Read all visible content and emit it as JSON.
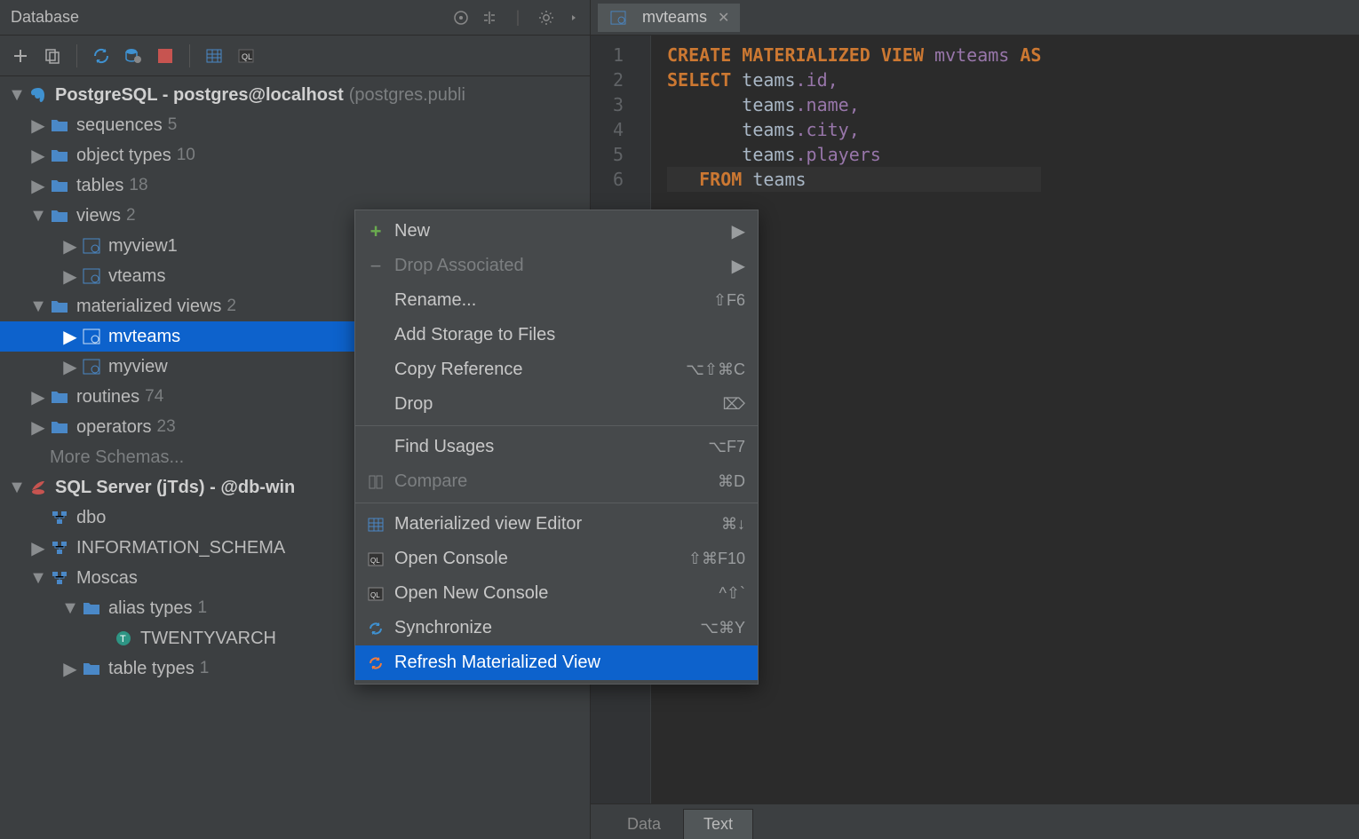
{
  "panel": {
    "title": "Database"
  },
  "tree": {
    "pg_label": "PostgreSQL - postgres@localhost",
    "pg_sub": "(postgres.publi",
    "sequences": {
      "label": "sequences",
      "count": "5"
    },
    "object_types": {
      "label": "object types",
      "count": "10"
    },
    "tables": {
      "label": "tables",
      "count": "18"
    },
    "views": {
      "label": "views",
      "count": "2"
    },
    "myview1": "myview1",
    "vteams": "vteams",
    "mviews": {
      "label": "materialized views",
      "count": "2"
    },
    "mvteams": "mvteams",
    "myview": "myview",
    "routines": {
      "label": "routines",
      "count": "74"
    },
    "operators": {
      "label": "operators",
      "count": "23"
    },
    "more_schemas": "More Schemas...",
    "mssql_label": "SQL Server (jTds) - @db-win",
    "dbo": "dbo",
    "info_schema": "INFORMATION_SCHEMA",
    "moscas": "Moscas",
    "alias_types": {
      "label": "alias types",
      "count": "1"
    },
    "twentyvarch": "TWENTYVARCH",
    "table_types": {
      "label": "table types",
      "count": "1"
    }
  },
  "tab": {
    "label": "mvteams"
  },
  "bottom_tabs": {
    "data": "Data",
    "text": "Text"
  },
  "code": {
    "l1a": "CREATE MATERIALIZED VIEW",
    "l1b": "mvteams",
    "l1c": "AS",
    "l2a": "SELECT",
    "l2b": "teams",
    "l2c": ".id,",
    "l3a": "teams",
    "l3b": ".name,",
    "l4a": "teams",
    "l4b": ".city,",
    "l5a": "teams",
    "l5b": ".players",
    "l6a": "FROM",
    "l6b": "teams"
  },
  "gutter": [
    "1",
    "2",
    "3",
    "4",
    "5",
    "6"
  ],
  "ctx": {
    "new": "New",
    "drop_assoc": "Drop Associated",
    "rename": "Rename...",
    "rename_sc": "⇧F6",
    "add_storage": "Add Storage to Files",
    "copy_ref": "Copy Reference",
    "copy_ref_sc": "⌥⇧⌘C",
    "drop": "Drop",
    "find_usages": "Find Usages",
    "find_usages_sc": "⌥F7",
    "compare": "Compare",
    "compare_sc": "⌘D",
    "mv_editor": "Materialized view Editor",
    "mv_editor_sc": "⌘↓",
    "open_console": "Open Console",
    "open_console_sc": "⇧⌘F10",
    "open_new_console": "Open New Console",
    "open_new_console_sc": "^⇧`",
    "sync": "Synchronize",
    "sync_sc": "⌥⌘Y",
    "refresh_mv": "Refresh Materialized View"
  }
}
